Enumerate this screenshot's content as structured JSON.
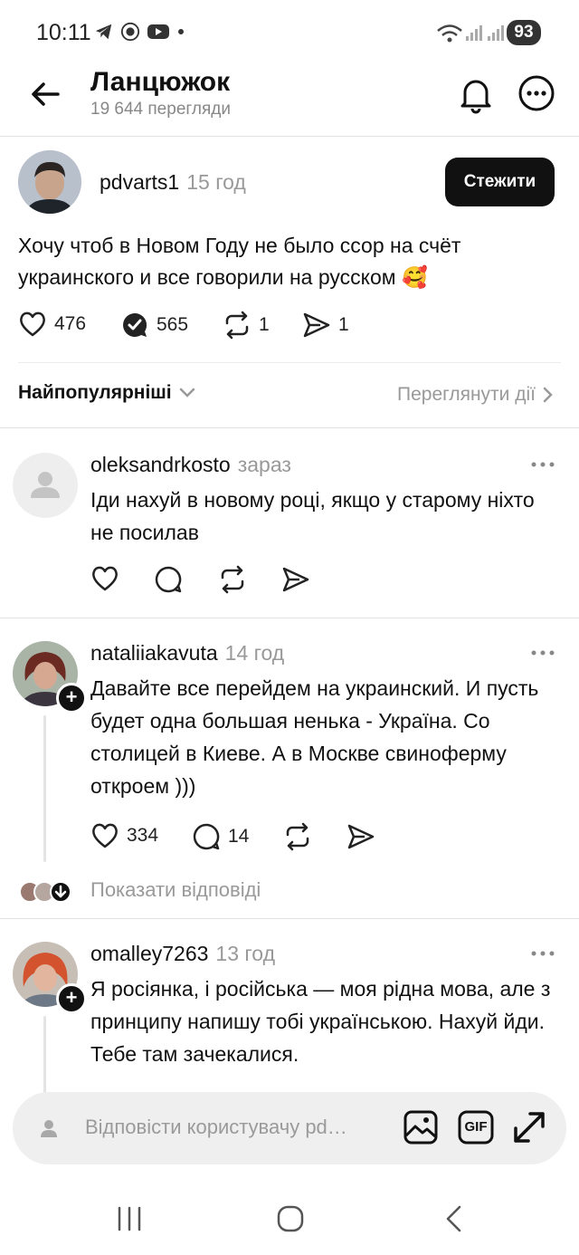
{
  "status_bar": {
    "time": "10:11",
    "battery": "93"
  },
  "header": {
    "title": "Ланцюжок",
    "views": "19 644 перегляди"
  },
  "post": {
    "username": "pdvarts1",
    "time": "15 год",
    "follow_label": "Стежити",
    "text": "Хочу чтоб в Новом Году не было ссор на счёт украинского и все говорили на русском 🥰",
    "likes": "476",
    "replies": "565",
    "reposts": "1",
    "shares": "1"
  },
  "sort": {
    "label": "Найпопулярніші",
    "view_activity": "Переглянути дії"
  },
  "replies": [
    {
      "username": "oleksandrkosto",
      "time": "зараз",
      "text": "Іди нахуй в новому році, якщо у старому ніхто не посилав"
    },
    {
      "username": "nataliiakavuta",
      "time": "14 год",
      "text": "Давайте все перейдем на украинский. И пусть будет одна большая ненька - Україна. Со столицей в Киеве. А в Москве свиноферму откроем )))",
      "likes": "334",
      "replies": "14",
      "show_replies": "Показати відповіді"
    },
    {
      "username": "omalley7263",
      "time": "13 год",
      "text": "Я росіянка, і російська — моя рідна мова, але з принципу напишу тобі українською. Нахуй йди.  Тебе там зачекалися."
    }
  ],
  "reply_bar": {
    "placeholder": "Відповісти користувачу pd…",
    "gif_label": "GIF"
  },
  "icons": [
    "back-arrow-icon",
    "bell-icon",
    "more-icon",
    "heart-icon",
    "comment-icon",
    "repost-icon",
    "share-icon",
    "chevron-down-icon",
    "chevron-right-icon",
    "image-icon",
    "gif-icon",
    "expand-icon"
  ]
}
